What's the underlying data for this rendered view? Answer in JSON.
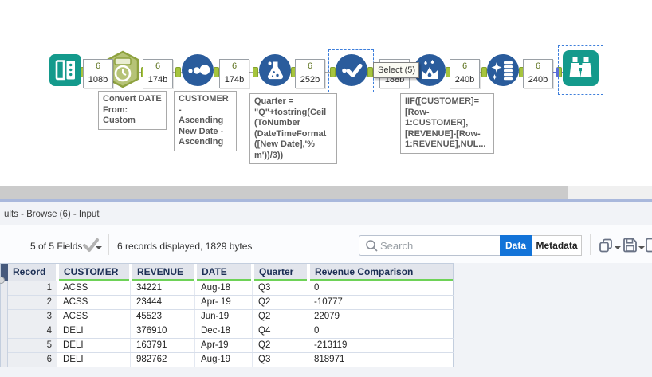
{
  "canvas": {
    "tooltip": "Select (5)",
    "labels": [
      {
        "count": "6",
        "size": "108b"
      },
      {
        "count": "6",
        "size": "174b"
      },
      {
        "count": "6",
        "size": "174b"
      },
      {
        "count": "6",
        "size": "252b"
      },
      {
        "count": "6",
        "size": "188b"
      },
      {
        "count": "6",
        "size": "240b"
      },
      {
        "count": "6",
        "size": "240b"
      }
    ],
    "annotations": [
      "Convert DATE\nFrom:\nCustom",
      "CUSTOMER -\nAscending\nNew Date -\nAscending",
      "Quarter =\n\"Q\"+tostring(Ceil\n(ToNumber\n(DateTimeFormat\n([New Date],'%\nm'))/3))",
      "IIF([CUSTOMER]=\n[Row-\n1:CUSTOMER],\n[REVENUE]-[Row-\n1:REVENUE],NUL..."
    ],
    "icons": {
      "input-data-tool": "open-book",
      "datetime-tool": "hexagon-clock",
      "sort-tool": "three-dots",
      "formula-tool": "flask",
      "select-tool": "checkmark",
      "multi-row-formula-tool": "crown-droplets",
      "data-cleansing-tool": "sparkle-grid",
      "browse-tool": "binoculars"
    }
  },
  "results": {
    "title": "ults - Browse (6) - Input",
    "fields_summary": "5 of 5 Fields",
    "records_summary": "6 records displayed, 1829 bytes",
    "search_placeholder": "Search",
    "tabs": {
      "data": "Data",
      "metadata": "Metadata"
    }
  },
  "table": {
    "headers": [
      "Record",
      "CUSTOMER",
      "REVENUE",
      "DATE",
      "Quarter",
      "Revenue Comparison"
    ],
    "rows": [
      [
        "1",
        "ACSS",
        "34221",
        "Aug-18",
        "Q3",
        "0"
      ],
      [
        "2",
        "ACSS",
        "23444",
        "Apr- 19",
        "Q2",
        "-10777"
      ],
      [
        "3",
        "ACSS",
        "45523",
        "Jun-19",
        "Q2",
        "22079"
      ],
      [
        "4",
        "DELI",
        "376910",
        "Dec-18",
        "Q4",
        "0"
      ],
      [
        "5",
        "DELI",
        "163791",
        "Apr-19",
        "Q2",
        "-213119"
      ],
      [
        "6",
        "DELI",
        "982762",
        "Aug-19",
        "Q3",
        "818971"
      ]
    ]
  },
  "colors": {
    "teal": "#149a8c",
    "tool_blue": "#2a5c9c",
    "anchor_green": "#a6c43e",
    "selection_blue": "#3d7edb",
    "data_tab_blue": "#1273d8",
    "header_underline_green": "#6ed257",
    "gutter_header_blue": "#46597c"
  }
}
